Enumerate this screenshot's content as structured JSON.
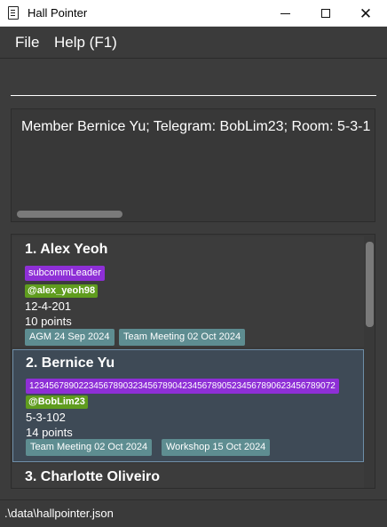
{
  "window": {
    "title": "Hall Pointer",
    "icon": "clipboard-icon"
  },
  "menu": {
    "file_label": "File",
    "help_label": "Help (F1)"
  },
  "command": {
    "value": "",
    "placeholder": ""
  },
  "result": {
    "text": "Member Bernice Yu; Telegram: BobLim23; Room: 5-3-1"
  },
  "members": [
    {
      "name": "1. Alex Yeoh",
      "role": "subcommLeader",
      "telegram": "@alex_yeoh98",
      "room": "12-4-201",
      "points": "10 points",
      "events": [
        "AGM 24 Sep 2024",
        "Team Meeting 02 Oct 2024"
      ]
    },
    {
      "name": "2. Bernice Yu",
      "role": "12345678902234567890323456789042345678905234567890623456789072",
      "telegram": "@BobLim23",
      "room": "5-3-102",
      "points": "14 points",
      "events": [
        "Team Meeting 02 Oct 2024",
        "Workshop 15 Oct 2024"
      ]
    },
    {
      "name": "3. Charlotte Oliveiro"
    }
  ],
  "status": {
    "path": ".\\data\\hallpointer.json"
  },
  "colors": {
    "background": "#3c3c3c",
    "role_tag": "#8e2fd6",
    "telegram_tag": "#5f9c1e",
    "event_tag": "#5e8d91",
    "selected_card": "#3e4a56"
  }
}
